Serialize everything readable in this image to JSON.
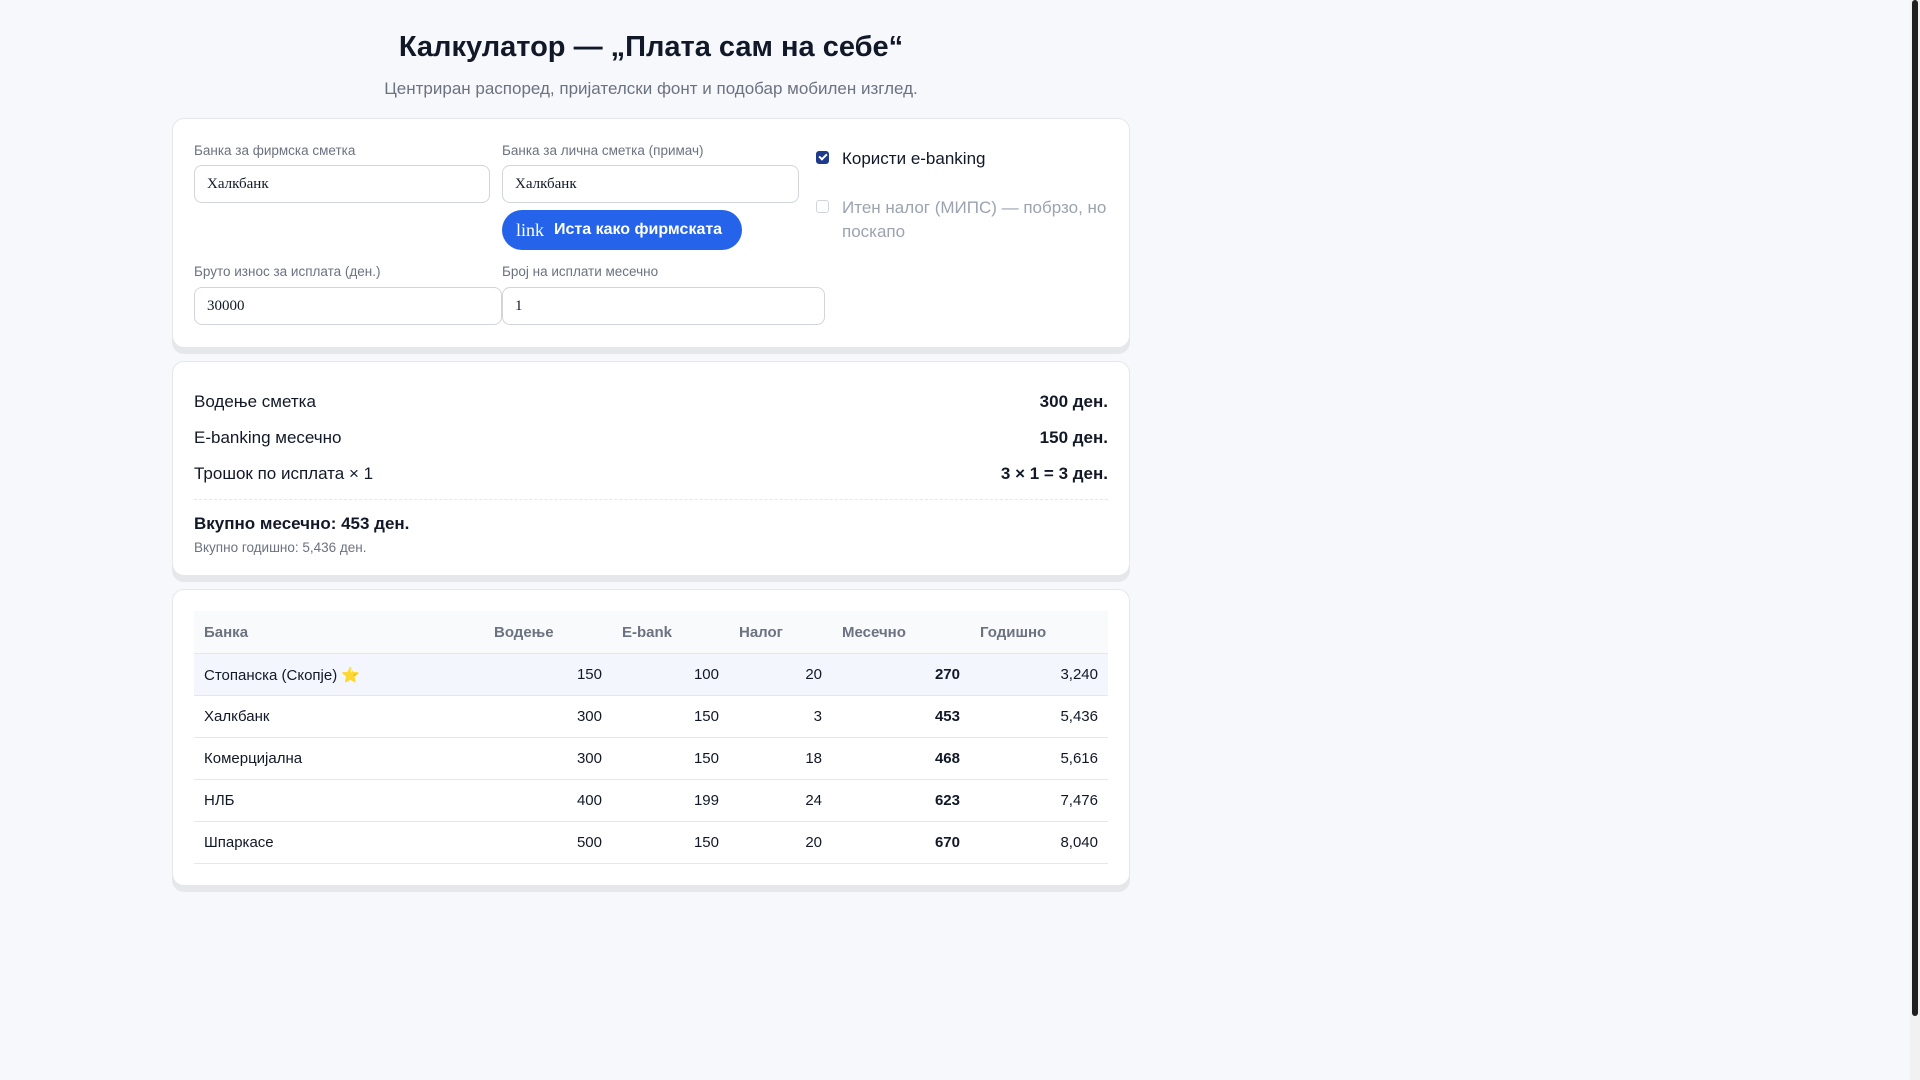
{
  "header": {
    "title": "Калкулатор — „Плата сам на себе“",
    "subtitle": "Центриран распоред, пријателски фонт и подобар мобилен изглед."
  },
  "form": {
    "company_bank_label": "Банка за фирмска сметка",
    "company_bank_value": "Халкбанк",
    "personal_bank_label": "Банка за лична сметка (примач)",
    "personal_bank_value": "Халкбанк",
    "same_as_company_button": "Иста како фирмската",
    "same_as_company_icon_text": "link",
    "gross_amount_label": "Бруто износ за исплата (ден.)",
    "gross_amount_value": "30000",
    "payments_per_month_label": "Број на исплати месечно",
    "payments_per_month_value": "1",
    "ebanking_label": "Користи e-banking",
    "ebanking_checked": true,
    "urgent_label": "Итен налог (МИПС) — побрзо, но поскапо",
    "urgent_checked": false
  },
  "summary": {
    "rows": [
      {
        "label": "Водење сметка",
        "value": "300 ден."
      },
      {
        "label": "E-banking месечно",
        "value": "150 ден."
      },
      {
        "label": "Трошок по исплата × 1",
        "value": "3 × 1 = 3 ден."
      }
    ],
    "total_monthly": "Вкупно месечно: 453 ден.",
    "total_yearly": "Вкупно годишно: 5,436 ден."
  },
  "table": {
    "headers": [
      "Банка",
      "Водење",
      "E-bank",
      "Налог",
      "Месечно",
      "Годишно"
    ],
    "rows": [
      {
        "bank": "Стопанска (Скопје)",
        "star": "⭐",
        "account": "150",
        "ebank": "100",
        "order": "20",
        "monthly": "270",
        "yearly": "3,240"
      },
      {
        "bank": "Халкбанк",
        "star": "",
        "account": "300",
        "ebank": "150",
        "order": "3",
        "monthly": "453",
        "yearly": "5,436"
      },
      {
        "bank": "Комерцијална",
        "star": "",
        "account": "300",
        "ebank": "150",
        "order": "18",
        "monthly": "468",
        "yearly": "5,616"
      },
      {
        "bank": "НЛБ",
        "star": "",
        "account": "400",
        "ebank": "199",
        "order": "24",
        "monthly": "623",
        "yearly": "7,476"
      },
      {
        "bank": "Шпаркасе",
        "star": "",
        "account": "500",
        "ebank": "150",
        "order": "20",
        "monthly": "670",
        "yearly": "8,040"
      }
    ]
  },
  "colors": {
    "accent": "#2563eb",
    "checkbox": "#1e3a8a",
    "highlight_row": "#f3f6fd",
    "star": "#f5b400"
  }
}
